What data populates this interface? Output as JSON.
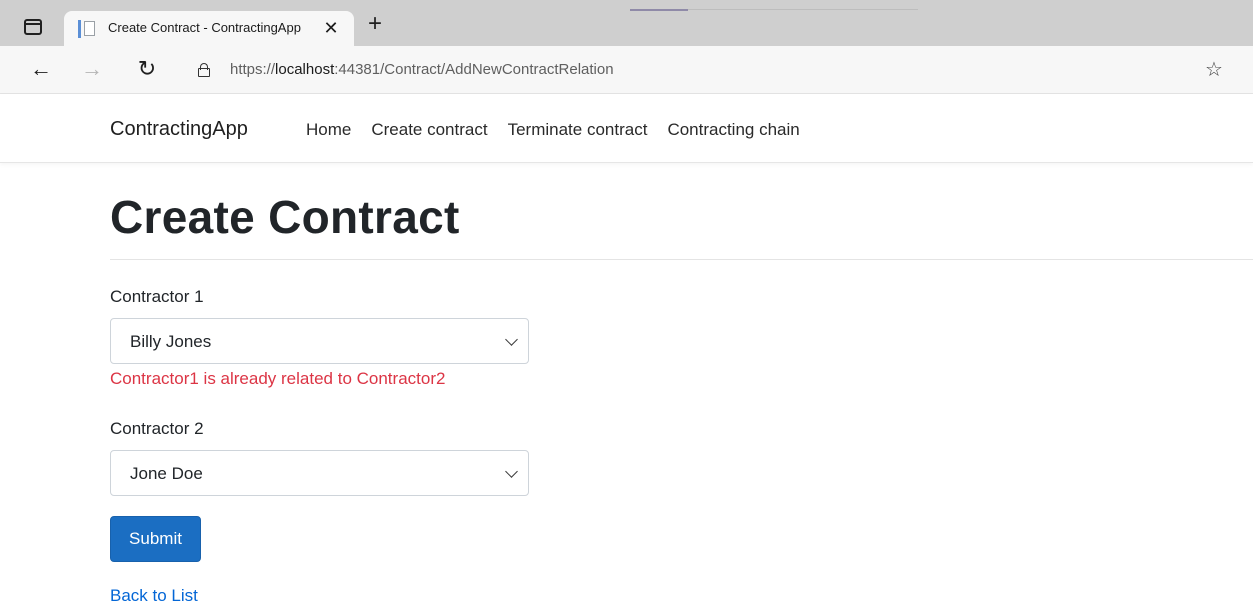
{
  "browser": {
    "tab_title": "Create Contract - ContractingApp",
    "tab_close_glyph": "✕",
    "new_tab_glyph": "+",
    "back_glyph": "←",
    "forward_glyph": "→",
    "refresh_glyph": "↻",
    "favorites_glyph": "☆",
    "url_scheme": "https://",
    "url_host": "localhost",
    "url_rest": ":44381/Contract/AddNewContractRelation"
  },
  "navbar": {
    "brand": "ContractingApp",
    "links": [
      {
        "label": "Home"
      },
      {
        "label": "Create contract"
      },
      {
        "label": "Terminate contract"
      },
      {
        "label": "Contracting chain"
      }
    ]
  },
  "form": {
    "title": "Create Contract",
    "contractor1": {
      "label": "Contractor 1",
      "selected": "Billy Jones",
      "error": "Contractor1 is already related to Contractor2"
    },
    "contractor2": {
      "label": "Contractor 2",
      "selected": "Jone Doe"
    },
    "submit_label": "Submit",
    "back_link": "Back to List"
  },
  "colors": {
    "primary": "#1b6ec2",
    "error": "#dc3545",
    "link": "#0366d6"
  },
  "icons": [
    "sidebar-icon",
    "favicon-icon",
    "close-icon",
    "plus-icon",
    "back-arrow-icon",
    "forward-arrow-icon",
    "refresh-icon",
    "lock-icon",
    "favorites-icon",
    "chevron-down-icon"
  ]
}
